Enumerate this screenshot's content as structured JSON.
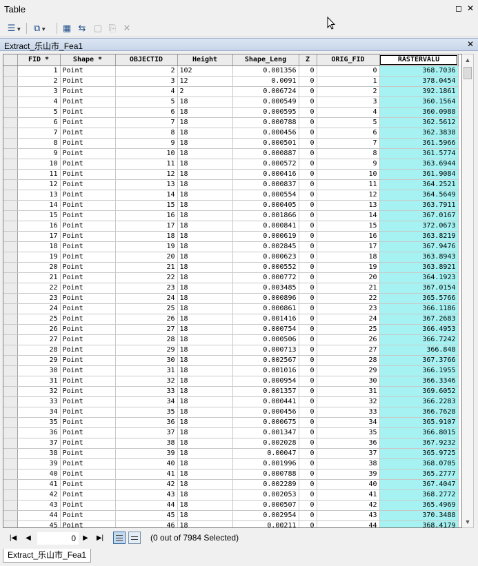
{
  "window": {
    "title": "Table"
  },
  "toolbar": {
    "items": [
      {
        "name": "table-options-icon",
        "glyph": "☰",
        "dim": false,
        "dropdown": true
      },
      {
        "name": "related-tables-icon",
        "glyph": "⧉",
        "dim": false,
        "dropdown": true
      },
      {
        "name": "select-by-attributes-icon",
        "glyph": "▦",
        "dim": false,
        "dropdown": false
      },
      {
        "name": "switch-selection-icon",
        "glyph": "⇆",
        "dim": false,
        "dropdown": false
      },
      {
        "name": "clear-selection-icon",
        "glyph": "▢",
        "dim": true,
        "dropdown": false
      },
      {
        "name": "zoom-to-selected-icon",
        "glyph": "⎘",
        "dim": true,
        "dropdown": false
      },
      {
        "name": "delete-selected-icon",
        "glyph": "✕",
        "dim": true,
        "dropdown": false
      }
    ]
  },
  "tab": {
    "title": "Extract_乐山市_Fea1"
  },
  "columns": [
    "FID *",
    "Shape *",
    "OBJECTID",
    "Height",
    "Shape_Leng",
    "Z",
    "ORIG_FID",
    "RASTERVALU"
  ],
  "rows": [
    [
      "1",
      "Point",
      "2",
      "102",
      "0.001356",
      "0",
      "0",
      "368.7036"
    ],
    [
      "2",
      "Point",
      "3",
      "12",
      "0.0091",
      "0",
      "1",
      "378.0454"
    ],
    [
      "3",
      "Point",
      "4",
      "2",
      "0.006724",
      "0",
      "2",
      "392.1861"
    ],
    [
      "4",
      "Point",
      "5",
      "18",
      "0.000549",
      "0",
      "3",
      "360.1564"
    ],
    [
      "5",
      "Point",
      "6",
      "18",
      "0.000595",
      "0",
      "4",
      "360.0988"
    ],
    [
      "6",
      "Point",
      "7",
      "18",
      "0.000788",
      "0",
      "5",
      "362.5612"
    ],
    [
      "7",
      "Point",
      "8",
      "18",
      "0.000456",
      "0",
      "6",
      "362.3838"
    ],
    [
      "8",
      "Point",
      "9",
      "18",
      "0.000501",
      "0",
      "7",
      "361.5966"
    ],
    [
      "9",
      "Point",
      "10",
      "18",
      "0.000887",
      "0",
      "8",
      "361.5774"
    ],
    [
      "10",
      "Point",
      "11",
      "18",
      "0.000572",
      "0",
      "9",
      "363.6944"
    ],
    [
      "11",
      "Point",
      "12",
      "18",
      "0.000416",
      "0",
      "10",
      "361.9084"
    ],
    [
      "12",
      "Point",
      "13",
      "18",
      "0.000837",
      "0",
      "11",
      "364.2521"
    ],
    [
      "13",
      "Point",
      "14",
      "18",
      "0.000554",
      "0",
      "12",
      "364.5649"
    ],
    [
      "14",
      "Point",
      "15",
      "18",
      "0.000405",
      "0",
      "13",
      "363.7911"
    ],
    [
      "15",
      "Point",
      "16",
      "18",
      "0.001866",
      "0",
      "14",
      "367.0167"
    ],
    [
      "16",
      "Point",
      "17",
      "18",
      "0.000841",
      "0",
      "15",
      "372.0673"
    ],
    [
      "17",
      "Point",
      "18",
      "18",
      "0.000619",
      "0",
      "16",
      "363.8219"
    ],
    [
      "18",
      "Point",
      "19",
      "18",
      "0.002845",
      "0",
      "17",
      "367.9476"
    ],
    [
      "19",
      "Point",
      "20",
      "18",
      "0.000623",
      "0",
      "18",
      "363.8943"
    ],
    [
      "20",
      "Point",
      "21",
      "18",
      "0.000552",
      "0",
      "19",
      "363.8921"
    ],
    [
      "21",
      "Point",
      "22",
      "18",
      "0.000772",
      "0",
      "20",
      "364.1923"
    ],
    [
      "22",
      "Point",
      "23",
      "18",
      "0.003485",
      "0",
      "21",
      "367.0154"
    ],
    [
      "23",
      "Point",
      "24",
      "18",
      "0.000896",
      "0",
      "22",
      "365.5766"
    ],
    [
      "24",
      "Point",
      "25",
      "18",
      "0.000861",
      "0",
      "23",
      "366.1186"
    ],
    [
      "25",
      "Point",
      "26",
      "18",
      "0.001416",
      "0",
      "24",
      "367.2683"
    ],
    [
      "26",
      "Point",
      "27",
      "18",
      "0.000754",
      "0",
      "25",
      "366.4953"
    ],
    [
      "27",
      "Point",
      "28",
      "18",
      "0.000506",
      "0",
      "26",
      "366.7242"
    ],
    [
      "28",
      "Point",
      "29",
      "18",
      "0.000713",
      "0",
      "27",
      "366.848"
    ],
    [
      "29",
      "Point",
      "30",
      "18",
      "0.002567",
      "0",
      "28",
      "367.3766"
    ],
    [
      "30",
      "Point",
      "31",
      "18",
      "0.001016",
      "0",
      "29",
      "366.1955"
    ],
    [
      "31",
      "Point",
      "32",
      "18",
      "0.000954",
      "0",
      "30",
      "366.3346"
    ],
    [
      "32",
      "Point",
      "33",
      "18",
      "0.001357",
      "0",
      "31",
      "369.6052"
    ],
    [
      "33",
      "Point",
      "34",
      "18",
      "0.000441",
      "0",
      "32",
      "366.2283"
    ],
    [
      "34",
      "Point",
      "35",
      "18",
      "0.000456",
      "0",
      "33",
      "366.7628"
    ],
    [
      "35",
      "Point",
      "36",
      "18",
      "0.000675",
      "0",
      "34",
      "365.9107"
    ],
    [
      "36",
      "Point",
      "37",
      "18",
      "0.001347",
      "0",
      "35",
      "366.8015"
    ],
    [
      "37",
      "Point",
      "38",
      "18",
      "0.002028",
      "0",
      "36",
      "367.9232"
    ],
    [
      "38",
      "Point",
      "39",
      "18",
      "0.00047",
      "0",
      "37",
      "365.9725"
    ],
    [
      "39",
      "Point",
      "40",
      "18",
      "0.001996",
      "0",
      "38",
      "368.0705"
    ],
    [
      "40",
      "Point",
      "41",
      "18",
      "0.000788",
      "0",
      "39",
      "365.2777"
    ],
    [
      "41",
      "Point",
      "42",
      "18",
      "0.002289",
      "0",
      "40",
      "367.4047"
    ],
    [
      "42",
      "Point",
      "43",
      "18",
      "0.002053",
      "0",
      "41",
      "368.2772"
    ],
    [
      "43",
      "Point",
      "44",
      "18",
      "0.000507",
      "0",
      "42",
      "365.4969"
    ],
    [
      "44",
      "Point",
      "45",
      "18",
      "0.002954",
      "0",
      "43",
      "370.3488"
    ],
    [
      "45",
      "Point",
      "46",
      "18",
      "0.00211",
      "0",
      "44",
      "368.4179"
    ]
  ],
  "navigation": {
    "current_record": "0",
    "status": "(0 out of 7984 Selected)"
  },
  "bottom_tab": {
    "label": "Extract_乐山市_Fea1"
  },
  "colors": {
    "highlight_column": "#a6f2f2",
    "tab_bar": "#c8d6ea"
  }
}
